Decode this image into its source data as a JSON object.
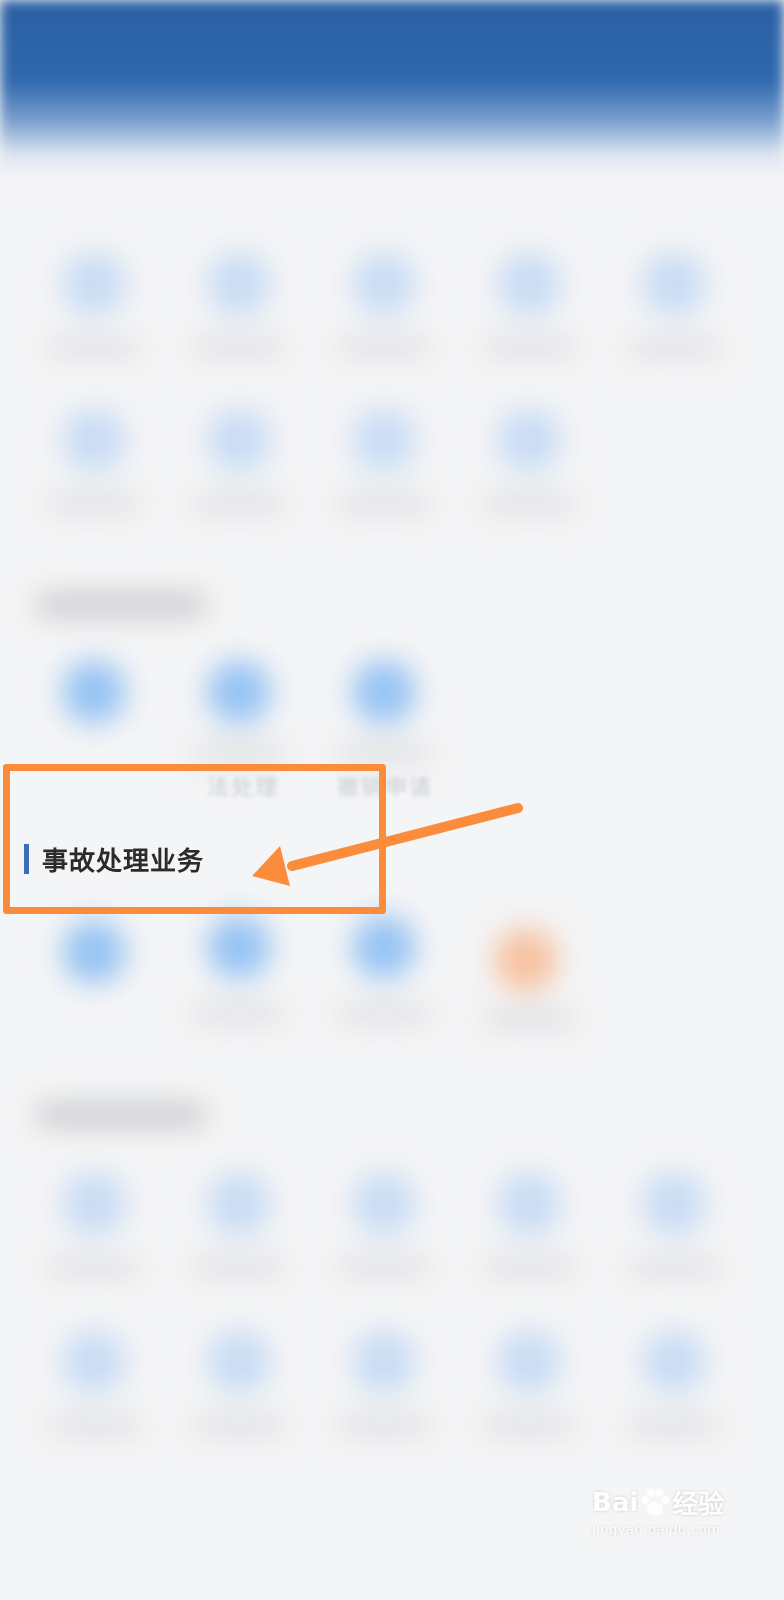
{
  "ghost_labels": [
    "法处理",
    "撤销申请"
  ],
  "section_title": "事故处理业务",
  "watermark": {
    "brand_left": "Bai",
    "brand_right": "经验",
    "url": "jingyan.baidu.com"
  },
  "colors": {
    "header_blue": "#2a5fa3",
    "highlight_orange": "#fb8c3c",
    "title_accent": "#3a6fb5"
  },
  "icons": {
    "paw": "paw-icon",
    "arrow": "arrow-icon"
  }
}
